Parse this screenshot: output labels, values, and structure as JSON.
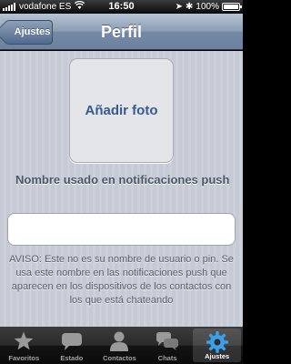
{
  "status_bar": {
    "carrier": "vodafone ES",
    "time": "16:50",
    "battery": "100%"
  },
  "nav": {
    "back_label": "Ajustes",
    "title": "Perfil"
  },
  "profile": {
    "photo_label": "Añadir foto",
    "field_label": "Nombre usado en notificaciones push",
    "name_value": "",
    "notice": "AVISO: Este no es su nombre de usuario o pin. Se usa este nombre en las notificaciones push que aparecen en los dispositivos de los contactos con los que está chateando"
  },
  "tabs": [
    {
      "label": "Favoritos",
      "icon": "star-icon"
    },
    {
      "label": "Estado",
      "icon": "speech-bubble-icon"
    },
    {
      "label": "Contactos",
      "icon": "person-icon"
    },
    {
      "label": "Chats",
      "icon": "chat-bubbles-icon"
    },
    {
      "label": "Ajustes",
      "icon": "gear-icon",
      "active": true
    }
  ],
  "colors": {
    "nav_bar": "#7489a4",
    "accent_text": "#395a8e",
    "background": "#c7ccd6"
  }
}
